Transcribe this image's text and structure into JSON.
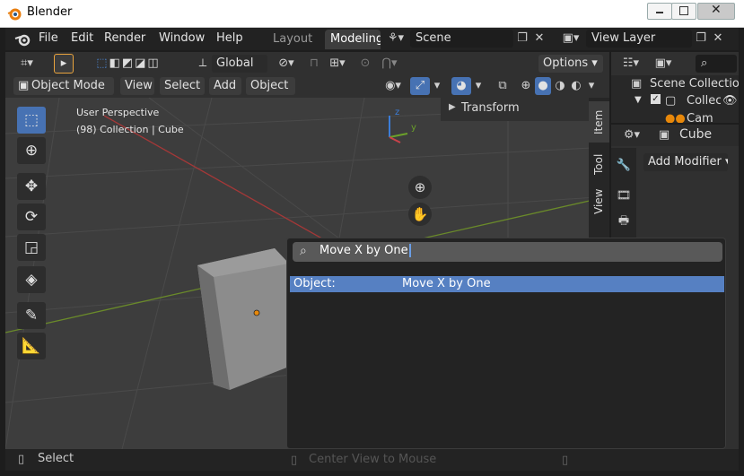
{
  "window": {
    "title": "Blender"
  },
  "menubar": {
    "items": [
      "File",
      "Edit",
      "Render",
      "Window",
      "Help"
    ]
  },
  "workspace_tabs": [
    "Layout",
    "Modeling"
  ],
  "scene": {
    "name": "Scene"
  },
  "view_layer": {
    "name": "View Layer"
  },
  "toolbar": {
    "transform_orientation": "Global",
    "options_label": "Options"
  },
  "header": {
    "mode": "Object Mode",
    "menus": [
      "View",
      "Select",
      "Add",
      "Object"
    ]
  },
  "viewport": {
    "perspective_label": "User Perspective",
    "collection_label": "(98) Collection | Cube",
    "gizmo_labels": {
      "x": "x",
      "y": "y",
      "z": "z"
    },
    "sidebar_tabs": [
      "Item",
      "Tool",
      "View"
    ],
    "transform_panel": "Transform"
  },
  "outliner": {
    "scene_collection": "Scene Collection",
    "collection": "Collection",
    "camera": "Camera"
  },
  "properties": {
    "object_name": "Cube",
    "add_modifier": "Add Modifier"
  },
  "search_popup": {
    "query": "Move X by One",
    "results": [
      {
        "category": "Object:",
        "name": "Move X by One"
      }
    ]
  },
  "statusbar": {
    "left": "Select",
    "center": "Center View to Mouse"
  },
  "colors": {
    "accent": "#4772b3",
    "selected_row": "#5680c2",
    "background": "#303030"
  }
}
